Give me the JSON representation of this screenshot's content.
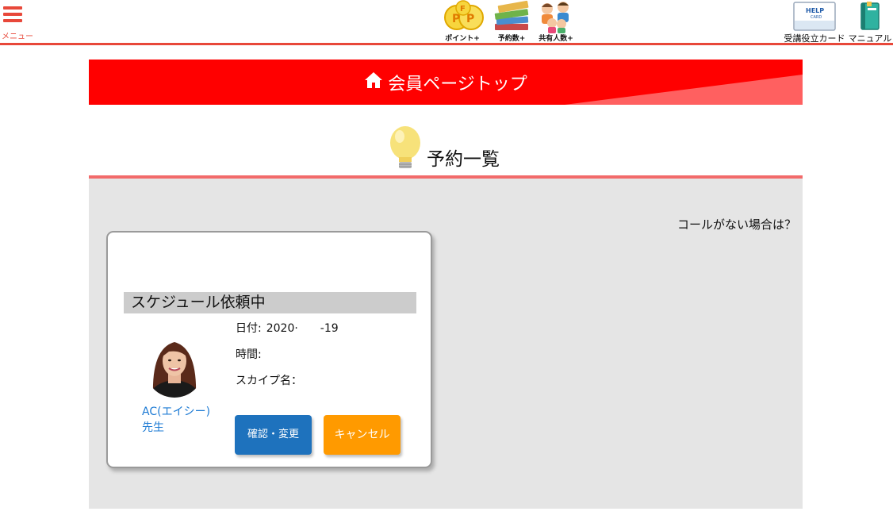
{
  "header": {
    "menu_label": "メニュー",
    "icons": [
      {
        "name": "points",
        "label": "ポイント+"
      },
      {
        "name": "reservations",
        "label": "予約数+"
      },
      {
        "name": "shared",
        "label": "共有人数+"
      }
    ],
    "help_card_text": "HELP",
    "help_card_sub": "CARD",
    "help_card_label": "受講役立カード",
    "manual_label": "マニュアル",
    "accent_color": "#e8483a"
  },
  "banner": {
    "title": "会員ページトップ",
    "color": "#ff0000"
  },
  "section": {
    "title": "予約一覧"
  },
  "content": {
    "no_call_link": "コールがない場合は？",
    "card": {
      "status": "スケジュール依頼中",
      "teacher_name": "AC(エイシー)先生",
      "date_label": "日付:",
      "date_value": "2020·　　-19",
      "time_label": "時間:",
      "time_value": "",
      "skype_label": "スカイプ名：",
      "skype_value": "",
      "confirm_button": "確認・変更",
      "cancel_button": "キャンセル",
      "confirm_color": "#1e72bd",
      "cancel_color": "#ff9a00"
    }
  }
}
